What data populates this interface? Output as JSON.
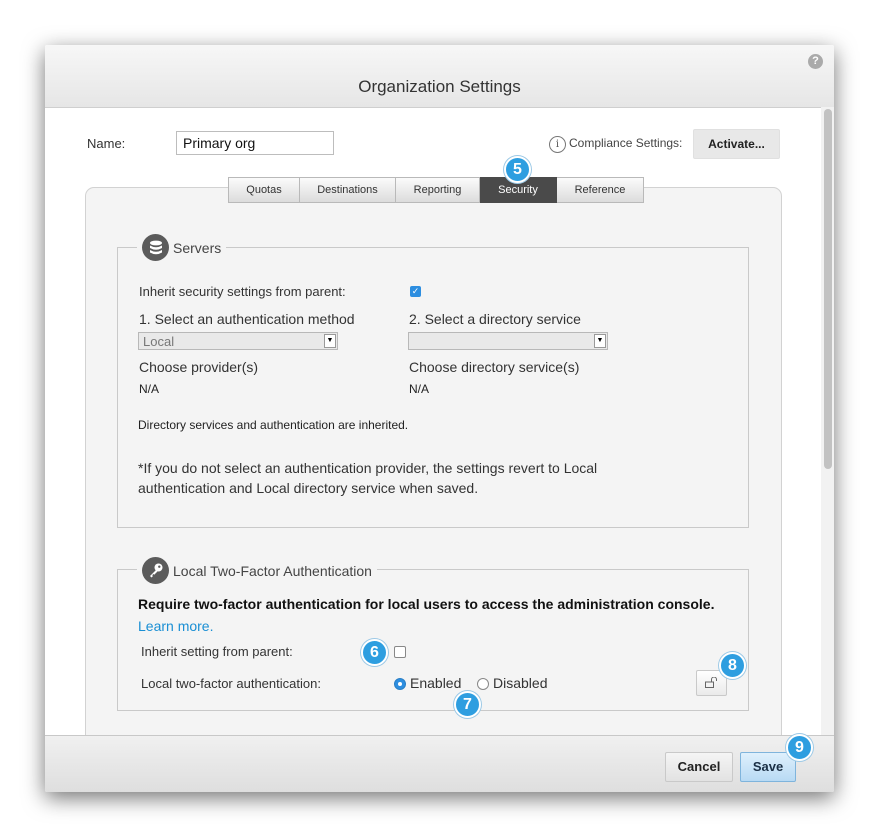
{
  "dialog": {
    "title": "Organization Settings",
    "help_icon": "help-icon",
    "help_glyph": "?"
  },
  "name_field": {
    "label": "Name:",
    "value": "Primary org"
  },
  "compliance": {
    "info_icon": "info-icon",
    "info_glyph": "i",
    "label": "Compliance Settings:",
    "button": "Activate..."
  },
  "tabs": [
    {
      "label": "Quotas"
    },
    {
      "label": "Destinations"
    },
    {
      "label": "Reporting"
    },
    {
      "label": "Security",
      "active": true
    },
    {
      "label": "Reference"
    }
  ],
  "servers": {
    "legend": "Servers",
    "icon": "database-icon",
    "inherit_label": "Inherit security settings from parent:",
    "inherit_checked": true,
    "auth_method_label": "1. Select an authentication method",
    "auth_method_value": "Local",
    "directory_label": "2. Select a directory service",
    "directory_value": "",
    "choose_provider_label": "Choose provider(s)",
    "choose_provider_value": "N/A",
    "choose_directory_label": "Choose directory service(s)",
    "choose_directory_value": "N/A",
    "inherited_note": "Directory services and authentication are inherited.",
    "note_line1": "*If you do not select an authentication provider, the settings revert to Local",
    "note_line2": "authentication and Local directory service when saved."
  },
  "two_factor": {
    "legend": "Local Two-Factor Authentication",
    "icon": "key-icon",
    "heading": "Require two-factor authentication for local users to access the administration console.",
    "learn_more": "Learn more.",
    "inherit_label": "Inherit setting from parent:",
    "inherit_checked": false,
    "option_label": "Local two-factor authentication:",
    "enabled_label": "Enabled",
    "disabled_label": "Disabled",
    "selected": "Enabled",
    "lock_icon": "unlock-icon"
  },
  "callouts": [
    "5",
    "6",
    "7",
    "8",
    "9"
  ],
  "footer": {
    "cancel": "Cancel",
    "save": "Save"
  },
  "colors": {
    "accent": "#2d8ee0",
    "callout": "#2e9ee0",
    "active_tab": "#4a4a4a",
    "link": "#1a8fd4"
  }
}
